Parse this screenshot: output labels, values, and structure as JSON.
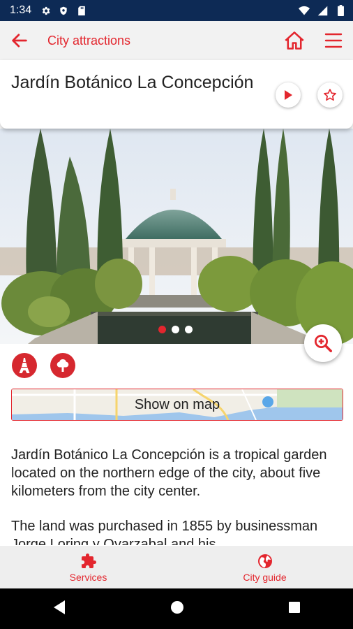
{
  "status_bar": {
    "time": "1:34"
  },
  "app_bar": {
    "title": "City attractions"
  },
  "attraction": {
    "name": "Jardín Botánico La Concepción",
    "gallery": {
      "image_count": 3,
      "active_index": 0
    }
  },
  "map_button": {
    "label": "Show on map"
  },
  "description": {
    "paragraphs": [
      "Jardín Botánico La Concepción is a tropical garden located on the northern edge of the city, about five kilometers from the city center.",
      "The land was purchased in 1855 by businessman Jorge Loring y Oyarzabal and his"
    ]
  },
  "bottom_nav": {
    "items": [
      {
        "label": "Services",
        "icon": "puzzle-icon"
      },
      {
        "label": "City guide",
        "icon": "globe-icon"
      }
    ]
  },
  "colors": {
    "accent": "#e3262e",
    "status_bar": "#0d2a55"
  }
}
